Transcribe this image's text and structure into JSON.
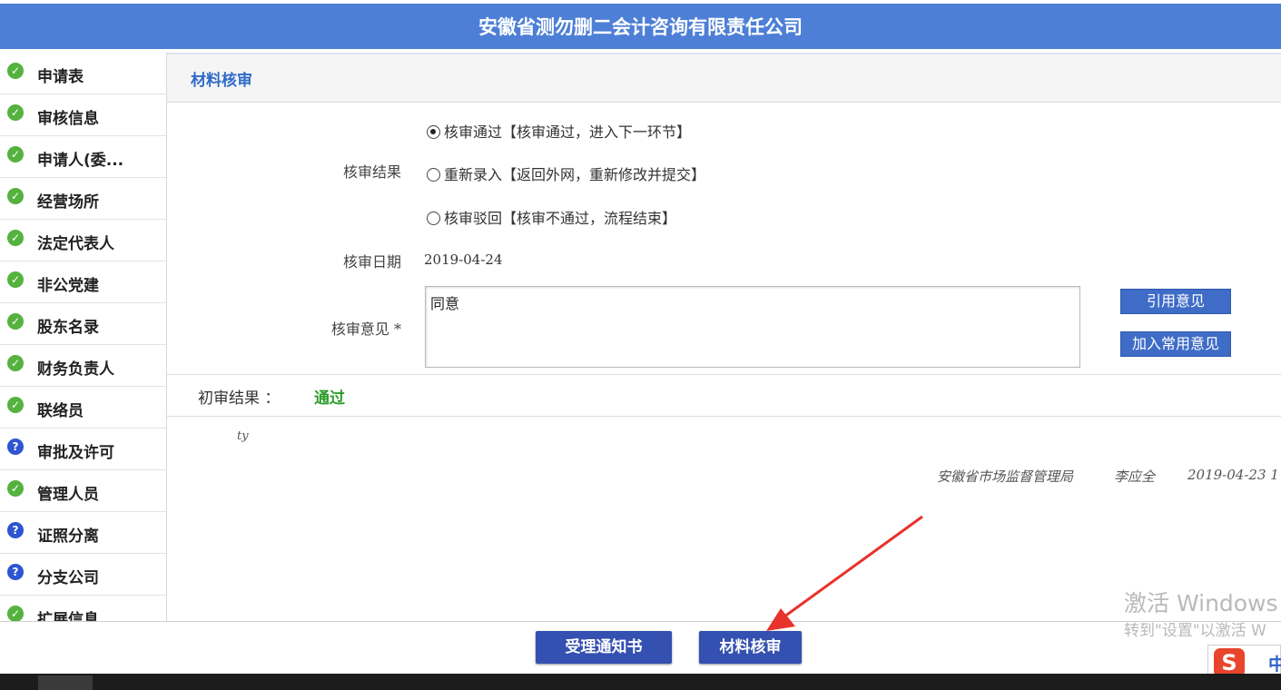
{
  "header": {
    "title": "安徽省测勿删二会计咨询有限责任公司"
  },
  "sidebar": {
    "items": [
      {
        "label": "申请表",
        "status": "done"
      },
      {
        "label": "审核信息",
        "status": "done"
      },
      {
        "label": "申请人(委...",
        "status": "done"
      },
      {
        "label": "经营场所",
        "status": "done"
      },
      {
        "label": "法定代表人",
        "status": "done"
      },
      {
        "label": "非公党建",
        "status": "done"
      },
      {
        "label": "股东名录",
        "status": "done"
      },
      {
        "label": "财务负责人",
        "status": "done"
      },
      {
        "label": "联络员",
        "status": "done"
      },
      {
        "label": "审批及许可",
        "status": "question"
      },
      {
        "label": "管理人员",
        "status": "done"
      },
      {
        "label": "证照分离",
        "status": "question"
      },
      {
        "label": "分支公司",
        "status": "question"
      },
      {
        "label": "扩展信息",
        "status": "done"
      }
    ]
  },
  "review": {
    "section_title": "材料核审",
    "result_label": "核审结果",
    "options": [
      {
        "label": "核审通过【核审通过，进入下一环节】",
        "selected": true
      },
      {
        "label": "重新录入【返回外网，重新修改并提交】",
        "selected": false
      },
      {
        "label": "核审驳回【核审不通过，流程结束】",
        "selected": false
      }
    ],
    "date_label": "核审日期",
    "date_value": "2019-04-24",
    "opinion_label": "核审意见 *",
    "opinion_value": "同意",
    "quote_button": "引用意见",
    "add_common_button": "加入常用意见"
  },
  "initial_review": {
    "label": "初审结果 ：",
    "value": "通过",
    "note": "ty",
    "signature": {
      "org": "安徽省市场监督管理局",
      "person": "李应全",
      "datetime": "2019-04-23 1"
    }
  },
  "bottom_bar": {
    "acceptance_notice_button": "受理通知书",
    "material_review_button": "材料核审"
  },
  "system": {
    "watermark_line1": "激活 Windows",
    "watermark_line2": "转到\"设置\"以激活 W",
    "ime_logo": "S",
    "ime_mode": "中"
  },
  "colors": {
    "header_bg": "#4d7fd6",
    "done_icon": "#55b23f",
    "question_icon": "#2d55d1",
    "pass_text": "#2a9c2a",
    "annotation_arrow": "#e8322c"
  }
}
